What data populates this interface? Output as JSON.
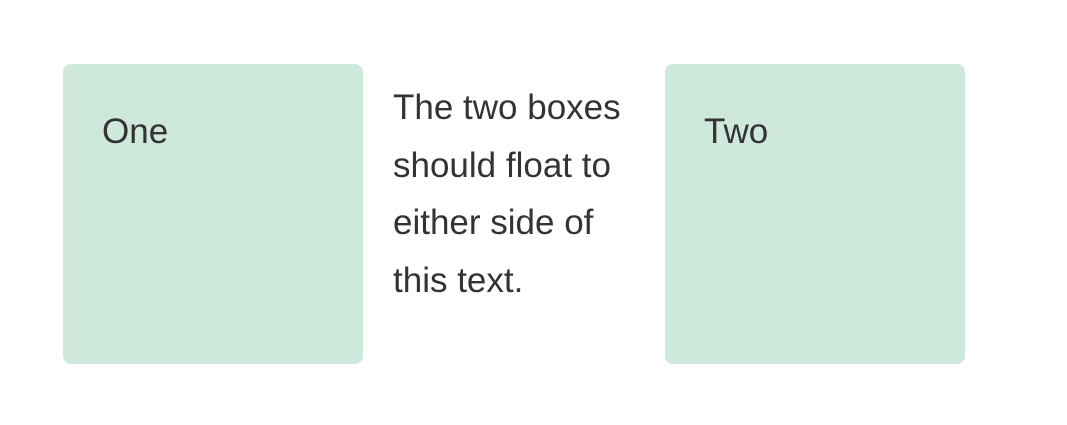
{
  "boxes": {
    "one_label": "One",
    "two_label": "Two",
    "color": "#cfe8dc"
  },
  "content": {
    "text": "The two boxes should float to either side of this text."
  },
  "colors": {
    "text": "#333333",
    "background": "#ffffff"
  }
}
